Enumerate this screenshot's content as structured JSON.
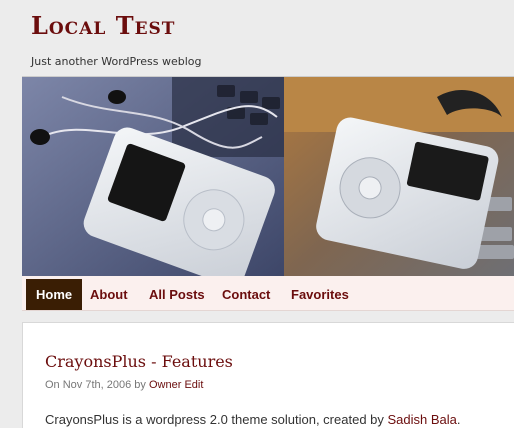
{
  "site": {
    "title": "Local Test",
    "tagline": "Just another WordPress weblog"
  },
  "nav": {
    "items": [
      {
        "label": "Home",
        "active": true
      },
      {
        "label": "About"
      },
      {
        "label": "All Posts"
      },
      {
        "label": "Contact"
      },
      {
        "label": "Favorites"
      }
    ]
  },
  "post": {
    "title": "CrayonsPlus - Features",
    "meta_prefix": "On Nov 7th, 2006 by",
    "author": "Owner",
    "edit": "Edit",
    "excerpt": "CrayonsPlus is a wordpress 2.0 theme solution, created by",
    "excerpt_link": "Sadish Bala",
    "excerpt_end": "."
  },
  "colors": {
    "accent": "#6b0d0d",
    "nav_active_bg": "#3a1e04",
    "nav_bg": "#fbf0ee",
    "page_bg": "#ececec"
  }
}
